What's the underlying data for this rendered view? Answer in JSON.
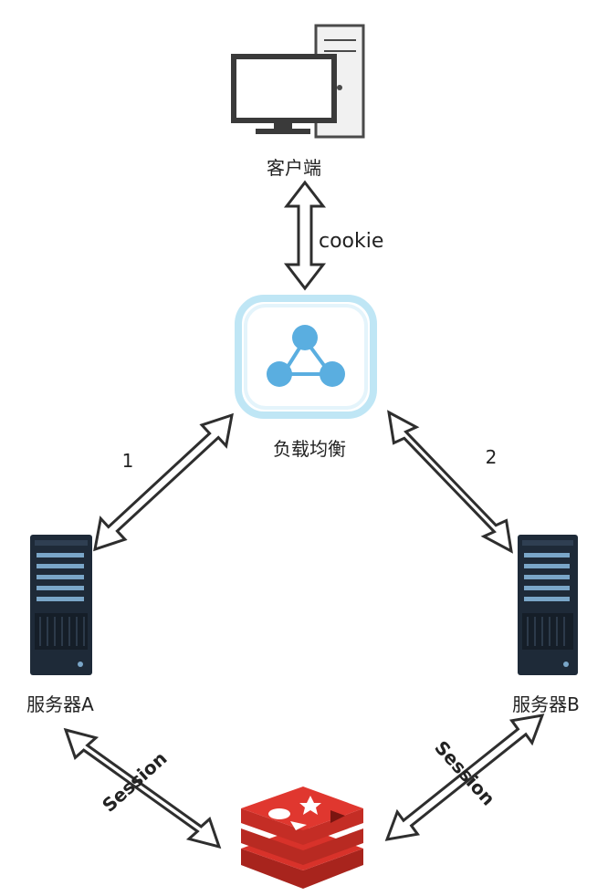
{
  "nodes": {
    "client": {
      "label": "客户端",
      "icon": "desktop-computer-icon"
    },
    "load_balancer": {
      "label": "负载均衡",
      "icon": "network-hub-icon",
      "accent": "#5aaee0"
    },
    "server_a": {
      "label": "服务器A",
      "icon": "server-rack-icon"
    },
    "server_b": {
      "label": "服务器B",
      "icon": "server-rack-icon"
    },
    "redis": {
      "icon": "redis-logo-icon",
      "color": "#d8322a"
    }
  },
  "edges": {
    "client_lb": {
      "label": "cookie"
    },
    "lb_a": {
      "label": "1"
    },
    "lb_b": {
      "label": "2"
    },
    "a_redis": {
      "label": "Session"
    },
    "b_redis": {
      "label": "Session"
    }
  }
}
